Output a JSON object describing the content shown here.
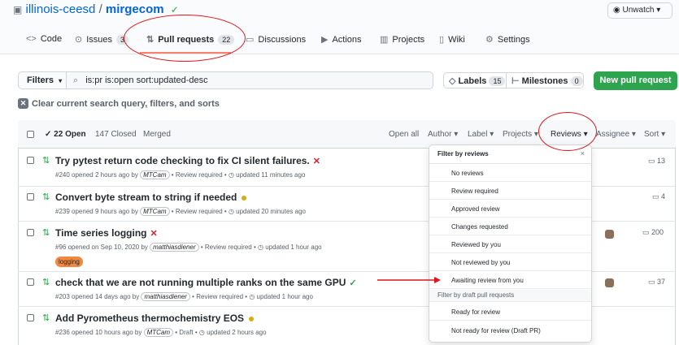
{
  "repo": {
    "owner": "illinois-ceesd",
    "separator": "/",
    "name": "mirgecom"
  },
  "watch": {
    "label": "Unwatch ▾"
  },
  "tabs": [
    {
      "label": "Code",
      "icon": "code-icon"
    },
    {
      "label": "Issues",
      "count": "3",
      "icon": "issue-icon"
    },
    {
      "label": "Pull requests",
      "count": "22",
      "icon": "pull-request-icon"
    },
    {
      "label": "Discussions",
      "icon": "discussion-icon"
    },
    {
      "label": "Actions",
      "icon": "play-icon"
    },
    {
      "label": "Projects",
      "icon": "project-icon"
    },
    {
      "label": "Wiki",
      "icon": "book-icon"
    },
    {
      "label": "Settings",
      "icon": "gear-icon"
    }
  ],
  "toolbar": {
    "filters_label": "Filters",
    "search_value": "is:pr is:open sort:updated-desc",
    "labels_label": "Labels",
    "labels_count": "15",
    "milestones_label": "Milestones",
    "milestones_count": "0",
    "new_pr_label": "New pull request",
    "clear_label": "Clear current search query, filters, and sorts"
  },
  "list_header": {
    "open": "22 Open",
    "closed": "147 Closed",
    "merged": "Merged",
    "open_all": "Open all",
    "author": "Author ▾",
    "label": "Label ▾",
    "projects": "Projects ▾",
    "reviews": "Reviews ▾",
    "assignee": "Assignee ▾",
    "sort": "Sort ▾"
  },
  "prs": [
    {
      "title": "Try pytest return code checking to fix CI silent failures.",
      "number": "#240",
      "opened": "opened 2 hours ago by",
      "author": "MTCam",
      "review": "Review required",
      "updated": "updated 11 minutes ago",
      "status": "failure",
      "comments": "13"
    },
    {
      "title": "Convert byte stream to string if needed",
      "number": "#239",
      "opened": "opened 9 hours ago by",
      "author": "MTCam",
      "review": "Review required",
      "updated": "updated 20 minutes ago",
      "status": "pending",
      "comments": "4"
    },
    {
      "title": "Time series logging",
      "number": "#96",
      "opened": "opened on Sep 10, 2020 by",
      "author": "matthiasdiener",
      "review": "Review required",
      "updated": "updated 1 hour ago",
      "status": "failure",
      "label": "logging",
      "comments": "200"
    },
    {
      "title": "check that we are not running multiple ranks on the same GPU",
      "number": "#203",
      "opened": "opened 14 days ago by",
      "author": "matthiasdiener",
      "review": "Review required",
      "updated": "updated 1 hour ago",
      "status": "success",
      "comments": "37"
    },
    {
      "title": "Add Pyrometheus thermochemistry EOS",
      "number": "#236",
      "opened": "opened 10 hours ago by",
      "author": "MTCam",
      "review": "Draft",
      "updated": "updated 2 hours ago",
      "status": "pending"
    }
  ],
  "dropdown": {
    "title": "Filter by reviews",
    "close": "×",
    "items": [
      "No reviews",
      "Review required",
      "Approved review",
      "Changes requested",
      "Reviewed by you",
      "Not reviewed by you",
      "Awaiting review from you"
    ],
    "draft_title": "Filter by draft pull requests",
    "draft_items": [
      "Ready for review",
      "Not ready for review (Draft PR)"
    ]
  },
  "colors": {
    "accent": "#0366d6",
    "green": "#2ea44f",
    "annotation_red": "#e0141e",
    "label_logging": "#f0883e"
  }
}
